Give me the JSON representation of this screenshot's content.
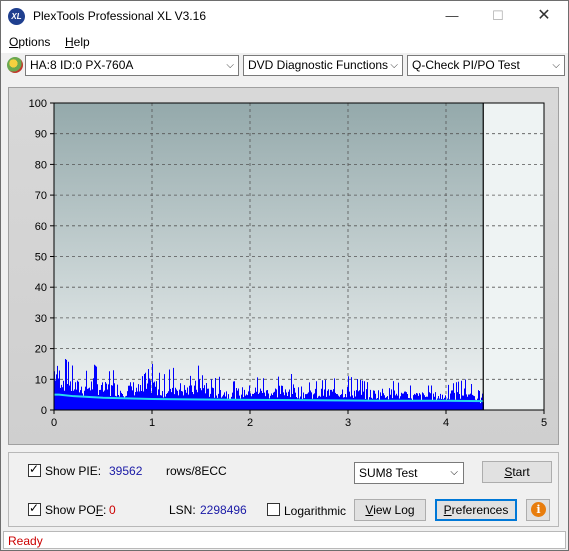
{
  "window": {
    "title": "PlexTools Professional XL V3.16",
    "app_icon_text": "XL",
    "minimize_glyph": "—",
    "maximize_glyph": "☐",
    "close_glyph": "✕"
  },
  "menu": {
    "options_first": "O",
    "options_rest": "ptions",
    "help_first": "H",
    "help_rest": "elp"
  },
  "toolbar": {
    "drive": "HA:8 ID:0  PX-760A",
    "function": "DVD Diagnostic Functions",
    "test": "Q-Check PI/PO Test",
    "arrow_glyph": "⌵"
  },
  "chart_data": {
    "type": "bar",
    "x_ticks": [
      "0",
      "1",
      "2",
      "3",
      "4",
      "5"
    ],
    "y_ticks": [
      "0",
      "10",
      "20",
      "30",
      "40",
      "50",
      "60",
      "70",
      "80",
      "90",
      "100"
    ],
    "xlim": [
      0,
      5
    ],
    "ylim": [
      0,
      100
    ],
    "x_end": 4.38,
    "grid": true,
    "colors": {
      "plot_top": "#94a9ab",
      "plot_bottom": "#f2f5f5",
      "pie_bars": "#0000ff",
      "pie_avg_line": "#27d7f0",
      "grid": "#555555"
    },
    "series": [
      {
        "x": [
          0.0,
          0.1,
          0.2,
          0.3,
          0.4,
          0.5,
          0.6,
          0.7,
          0.8,
          0.9,
          1.0,
          1.1,
          1.2,
          1.3,
          1.4,
          1.5,
          1.6,
          1.7,
          1.8,
          1.9,
          2.0,
          2.2,
          2.4,
          2.6,
          2.8,
          3.0,
          3.2,
          3.4,
          3.6,
          3.8,
          4.0,
          4.2,
          4.38
        ],
        "values": [
          22,
          17,
          14,
          12,
          15,
          12,
          13,
          11,
          13,
          11,
          15,
          11,
          14,
          12,
          11,
          16,
          10,
          11,
          9,
          10,
          11,
          10,
          12,
          9,
          10,
          11,
          9,
          10,
          8,
          8,
          8,
          10,
          5
        ]
      },
      {
        "x": [
          0.0,
          0.05,
          0.2,
          0.5,
          1.0,
          1.5,
          2.0,
          2.5,
          3.0,
          3.5,
          4.0,
          4.38
        ],
        "values": [
          5,
          5,
          4.5,
          4,
          3.6,
          3.4,
          3.3,
          3.2,
          3.1,
          3.0,
          3.0,
          2.9
        ]
      }
    ]
  },
  "controls": {
    "show_pie_label": "Show PIE:",
    "pie_value": "39562",
    "rows_label": "rows/8ECC",
    "show_pof_label_pre": "Show PO",
    "show_pof_label_ul": "F",
    "show_pof_label_post": ":",
    "pof_value": "0",
    "lsn_label": "LSN:",
    "lsn_value": "2298496",
    "logarithmic_label": "Logarithmic",
    "sum8_option": "SUM8 Test",
    "start_first": "S",
    "start_rest": "tart",
    "view_log_pre": "",
    "view_log_ul": "V",
    "view_log_rest": "iew Log",
    "preferences_first": "P",
    "preferences_rest": "references",
    "info_glyph": "i"
  },
  "status": {
    "text": "Ready"
  }
}
